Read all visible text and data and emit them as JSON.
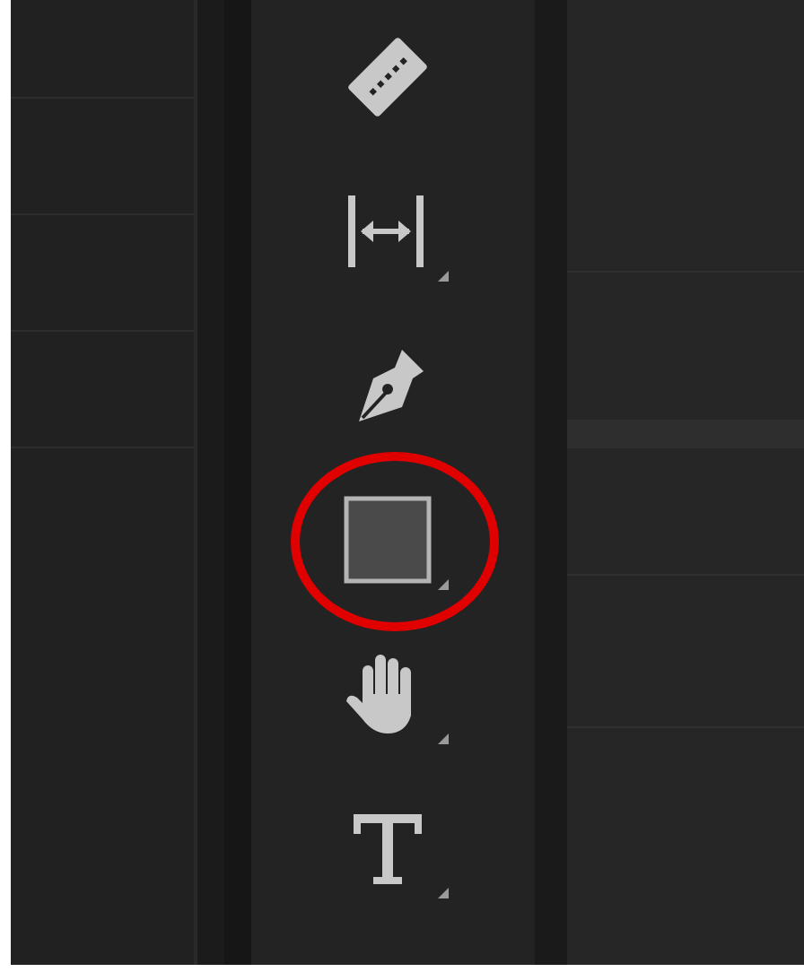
{
  "tools": [
    {
      "kind": "razor",
      "submenu": false,
      "highlighted": false
    },
    {
      "kind": "slip",
      "submenu": true,
      "highlighted": false
    },
    {
      "kind": "pen",
      "submenu": false,
      "highlighted": false
    },
    {
      "kind": "rectangle",
      "submenu": true,
      "highlighted": true
    },
    {
      "kind": "hand",
      "submenu": true,
      "highlighted": false
    },
    {
      "kind": "type",
      "submenu": true,
      "highlighted": false
    }
  ]
}
